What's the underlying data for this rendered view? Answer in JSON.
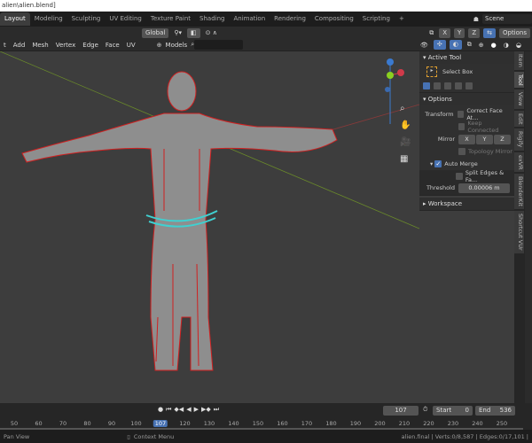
{
  "title": "alien\\alien.blend]",
  "workspaces": [
    "Layout",
    "Modeling",
    "Sculpting",
    "UV Editing",
    "Texture Paint",
    "Shading",
    "Animation",
    "Rendering",
    "Compositing",
    "Scripting",
    "+"
  ],
  "scene": "Scene",
  "header1": {
    "orientation": "Global",
    "axes": [
      "X",
      "Y",
      "Z"
    ],
    "options": "Options"
  },
  "header2": {
    "menus": [
      "t",
      "Add",
      "Mesh",
      "Vertex",
      "Edge",
      "Face",
      "UV"
    ],
    "collection": "Models",
    "search_placeholder": ""
  },
  "sidebar": {
    "active_tool": "Active Tool",
    "tool_name": "Select Box",
    "options": "Options",
    "transform_label": "Transform",
    "correct_face": "Correct Face At...",
    "keep_connected": "Keep Connected",
    "mirror_label": "Mirror",
    "mirror_axes": [
      "X",
      "Y",
      "Z"
    ],
    "topology_mirror": "Topology Mirror",
    "auto_merge": "Auto Merge",
    "split_edges": "Split Edges & Fa...",
    "threshold_label": "Threshold",
    "threshold": "0.00006 m",
    "workspace": "Workspace"
  },
  "vtabs": [
    "Item",
    "Tool",
    "View",
    "Edit",
    "Rigify",
    "exVR",
    "BlenderKit",
    "Shortcut VUr"
  ],
  "timeline": {
    "current": "107",
    "start_label": "Start",
    "start": "0",
    "end_label": "End",
    "end": "536",
    "ticks": [
      "50",
      "60",
      "70",
      "80",
      "90",
      "100",
      "107",
      "120",
      "130",
      "140",
      "150",
      "160",
      "170",
      "180",
      "190",
      "200",
      "210",
      "220",
      "230",
      "240",
      "250"
    ]
  },
  "status": {
    "left": "Pan View",
    "middle": "Context Menu",
    "right": "alien.final | Verts:0/8,587 | Edges:0/17,101 |"
  },
  "colors": {
    "accent": "#4772b3",
    "seam": "#e02020",
    "mesh": "#9a9a9a",
    "selected": "#40d0d0"
  }
}
